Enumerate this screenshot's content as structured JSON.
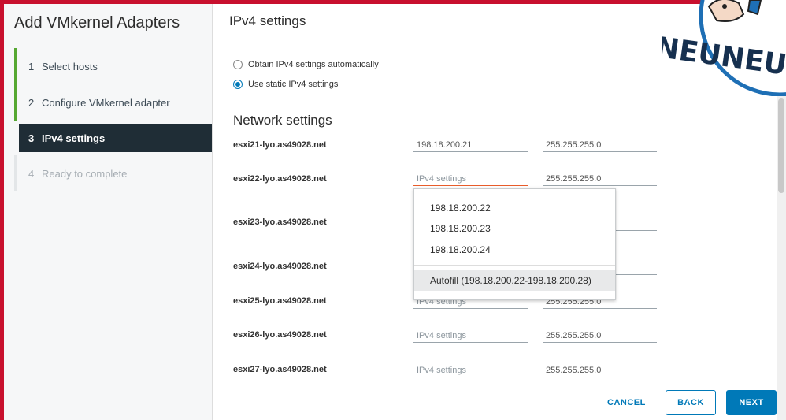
{
  "wizard": {
    "title": "Add VMkernel Adapters",
    "steps": [
      {
        "num": "1",
        "label": "Select hosts"
      },
      {
        "num": "2",
        "label": "Configure VMkernel adapter"
      },
      {
        "num": "3",
        "label": "IPv4 settings"
      },
      {
        "num": "4",
        "label": "Ready to complete"
      }
    ]
  },
  "page": {
    "title": "IPv4 settings",
    "radio_auto": "Obtain IPv4 settings automatically",
    "radio_static": "Use static IPv4 settings",
    "section_title": "Network settings"
  },
  "hosts": [
    {
      "name": "esxi21-lyo.as49028.net",
      "ip": "198.18.200.21",
      "ip_placeholder": "IPv4 settings",
      "mask": "255.255.255.0"
    },
    {
      "name": "esxi22-lyo.as49028.net",
      "ip": "",
      "ip_placeholder": "IPv4 settings",
      "mask": "255.255.255.0"
    },
    {
      "name": "esxi23-lyo.as49028.net",
      "ip": "",
      "ip_placeholder": "IPv4 settings",
      "mask": ""
    },
    {
      "name": "esxi24-lyo.as49028.net",
      "ip": "",
      "ip_placeholder": "IPv4 settings",
      "mask": ""
    },
    {
      "name": "esxi25-lyo.as49028.net",
      "ip": "",
      "ip_placeholder": "IPv4 settings",
      "mask": "255.255.255.0"
    },
    {
      "name": "esxi26-lyo.as49028.net",
      "ip": "",
      "ip_placeholder": "IPv4 settings",
      "mask": "255.255.255.0"
    },
    {
      "name": "esxi27-lyo.as49028.net",
      "ip": "",
      "ip_placeholder": "IPv4 settings",
      "mask": "255.255.255.0"
    }
  ],
  "dropdown": {
    "options": [
      "198.18.200.22",
      "198.18.200.23",
      "198.18.200.24"
    ],
    "autofill": "Autofill (198.18.200.22-198.18.200.28)"
  },
  "footer": {
    "cancel": "CANCEL",
    "back": "BACK",
    "next": "NEXT"
  },
  "logo": {
    "text": "NEUNEU"
  },
  "colors": {
    "accent": "#0079b8",
    "step_done": "#56a832",
    "active_step_bg": "#1f2d36",
    "focus_underline": "#e85d2a",
    "frame": "#c8102e"
  }
}
